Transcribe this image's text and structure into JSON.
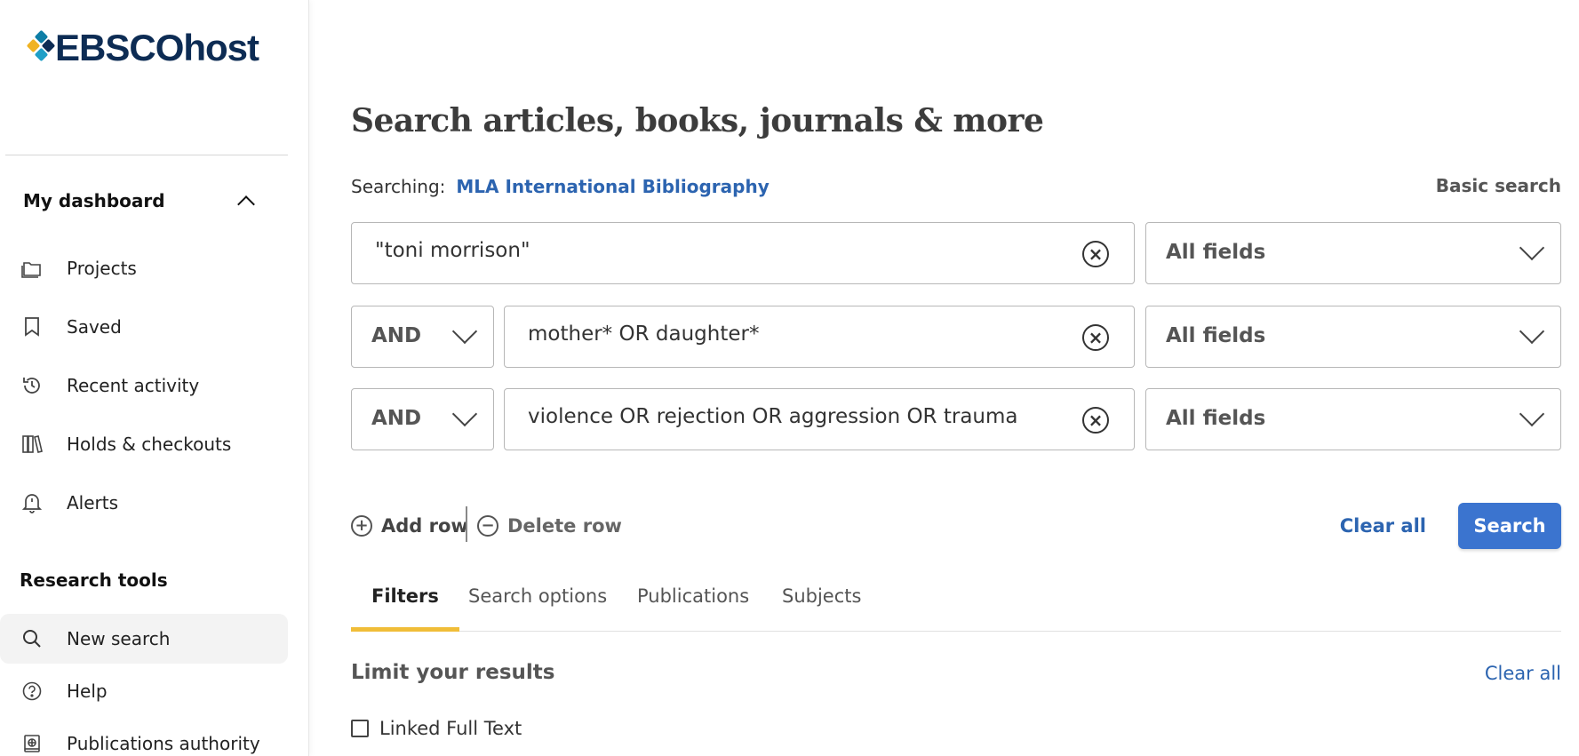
{
  "sidebar": {
    "logo_text": "EBSCOhost",
    "dashboard_title": "My dashboard",
    "dashboard_items": [
      {
        "label": "Projects",
        "icon": "folder-icon"
      },
      {
        "label": "Saved",
        "icon": "bookmark-icon"
      },
      {
        "label": "Recent activity",
        "icon": "history-icon"
      },
      {
        "label": "Holds & checkouts",
        "icon": "books-icon"
      },
      {
        "label": "Alerts",
        "icon": "bell-icon"
      }
    ],
    "research_title": "Research tools",
    "research_items": [
      {
        "label": "New search",
        "icon": "search-icon",
        "active": true
      },
      {
        "label": "Help",
        "icon": "help-icon"
      },
      {
        "label": "Publications authority",
        "icon": "book-globe-icon"
      }
    ]
  },
  "main": {
    "title": "Search articles, books, journals & more",
    "searching_label": "Searching:",
    "database": "MLA International Bibliography",
    "basic_search": "Basic search",
    "rows": [
      {
        "operator": null,
        "term": "\"toni morrison\"",
        "field": "All fields"
      },
      {
        "operator": "AND",
        "term": "mother* OR daughter*",
        "field": "All fields"
      },
      {
        "operator": "AND",
        "term": "violence OR rejection OR aggression OR trauma",
        "field": "All fields"
      }
    ],
    "add_row": "Add row",
    "delete_row": "Delete row",
    "clear_all": "Clear all",
    "search": "Search",
    "tabs": [
      "Filters",
      "Search options",
      "Publications",
      "Subjects"
    ],
    "limit_title": "Limit your results",
    "limit_clear_all": "Clear all",
    "linked_full_text": "Linked Full Text"
  },
  "colors": {
    "brand_navy": "#0d2c54",
    "link_blue": "#2c64b0",
    "button_blue": "#3b74cf",
    "tab_accent": "#f0bd38"
  }
}
